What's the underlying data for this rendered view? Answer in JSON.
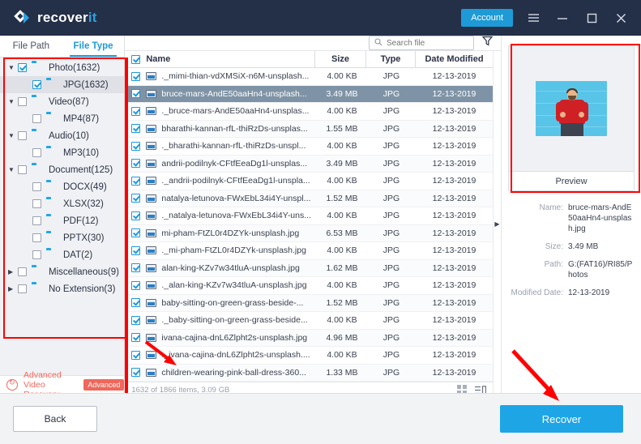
{
  "titlebar": {
    "logo_text_main": "recover",
    "logo_text_accent": "it",
    "account_label": "Account",
    "menu_icon": "hamburger-menu-icon",
    "minimize_icon": "minimize-icon",
    "maximize_icon": "maximize-icon",
    "close_icon": "close-icon",
    "bg_color": "#242f48",
    "accent_color": "#1e9ad6"
  },
  "sidebar": {
    "tabs": [
      {
        "label": "File Path",
        "active": false
      },
      {
        "label": "File Type",
        "active": true
      }
    ],
    "tree": [
      {
        "label": "Photo(1632)",
        "level": 0,
        "checked": true,
        "chevron": "open",
        "icon": "photo-icon",
        "selected": false
      },
      {
        "label": "JPG(1632)",
        "level": 1,
        "checked": true,
        "chevron": "none",
        "icon": "folder-icon",
        "selected": true
      },
      {
        "label": "Video(87)",
        "level": 0,
        "checked": false,
        "chevron": "open",
        "icon": "video-icon",
        "selected": false
      },
      {
        "label": "MP4(87)",
        "level": 1,
        "checked": false,
        "chevron": "none",
        "icon": "folder-icon",
        "selected": false
      },
      {
        "label": "Audio(10)",
        "level": 0,
        "checked": false,
        "chevron": "open",
        "icon": "audio-icon",
        "selected": false
      },
      {
        "label": "MP3(10)",
        "level": 1,
        "checked": false,
        "chevron": "none",
        "icon": "folder-icon",
        "selected": false
      },
      {
        "label": "Document(125)",
        "level": 0,
        "checked": false,
        "chevron": "open",
        "icon": "document-icon",
        "selected": false
      },
      {
        "label": "DOCX(49)",
        "level": 1,
        "checked": false,
        "chevron": "none",
        "icon": "folder-icon",
        "selected": false
      },
      {
        "label": "XLSX(32)",
        "level": 1,
        "checked": false,
        "chevron": "none",
        "icon": "folder-icon",
        "selected": false
      },
      {
        "label": "PDF(12)",
        "level": 1,
        "checked": false,
        "chevron": "none",
        "icon": "folder-icon",
        "selected": false
      },
      {
        "label": "PPTX(30)",
        "level": 1,
        "checked": false,
        "chevron": "none",
        "icon": "folder-icon",
        "selected": false
      },
      {
        "label": "DAT(2)",
        "level": 1,
        "checked": false,
        "chevron": "none",
        "icon": "folder-icon",
        "selected": false
      },
      {
        "label": "Miscellaneous(9)",
        "level": 0,
        "checked": false,
        "chevron": "closed",
        "icon": "misc-icon",
        "selected": false
      },
      {
        "label": "No Extension(3)",
        "level": 0,
        "checked": false,
        "chevron": "closed",
        "icon": "folder-icon",
        "selected": false
      }
    ],
    "advanced": {
      "label": "Advanced Video Recovery",
      "badge": "Advanced",
      "icon": "refresh-video-icon",
      "color": "#f0675c"
    }
  },
  "search": {
    "placeholder": "Search file",
    "value": "",
    "search_icon": "search-icon",
    "filter_icon": "filter-funnel-icon"
  },
  "filelist": {
    "columns": [
      "Name",
      "Size",
      "Type",
      "Date Modified"
    ],
    "header_checkbox_checked": true,
    "rows": [
      {
        "name": "._mimi-thian-vdXMSiX-n6M-unsplash...",
        "size": "4.00  KB",
        "type": "JPG",
        "date": "12-13-2019",
        "checked": true,
        "selected": false
      },
      {
        "name": "bruce-mars-AndE50aaHn4-unsplash...",
        "size": "3.49  MB",
        "type": "JPG",
        "date": "12-13-2019",
        "checked": true,
        "selected": true
      },
      {
        "name": "._bruce-mars-AndE50aaHn4-unsplas...",
        "size": "4.00  KB",
        "type": "JPG",
        "date": "12-13-2019",
        "checked": true,
        "selected": false
      },
      {
        "name": "bharathi-kannan-rfL-thiRzDs-unsplas...",
        "size": "1.55  MB",
        "type": "JPG",
        "date": "12-13-2019",
        "checked": true,
        "selected": false
      },
      {
        "name": "._bharathi-kannan-rfL-thiRzDs-unspl...",
        "size": "4.00  KB",
        "type": "JPG",
        "date": "12-13-2019",
        "checked": true,
        "selected": false
      },
      {
        "name": "andrii-podilnyk-CFtfEeaDg1l-unsplas...",
        "size": "3.49  MB",
        "type": "JPG",
        "date": "12-13-2019",
        "checked": true,
        "selected": false
      },
      {
        "name": "._andrii-podilnyk-CFtfEeaDg1l-unspla...",
        "size": "4.00  KB",
        "type": "JPG",
        "date": "12-13-2019",
        "checked": true,
        "selected": false
      },
      {
        "name": "natalya-letunova-FWxEbL34i4Y-unspl...",
        "size": "1.52  MB",
        "type": "JPG",
        "date": "12-13-2019",
        "checked": true,
        "selected": false
      },
      {
        "name": "._natalya-letunova-FWxEbL34i4Y-uns...",
        "size": "4.00  KB",
        "type": "JPG",
        "date": "12-13-2019",
        "checked": true,
        "selected": false
      },
      {
        "name": "mi-pham-FtZL0r4DZYk-unsplash.jpg",
        "size": "6.53  MB",
        "type": "JPG",
        "date": "12-13-2019",
        "checked": true,
        "selected": false
      },
      {
        "name": "._mi-pham-FtZL0r4DZYk-unsplash.jpg",
        "size": "4.00  KB",
        "type": "JPG",
        "date": "12-13-2019",
        "checked": true,
        "selected": false
      },
      {
        "name": "alan-king-KZv7w34tluA-unsplash.jpg",
        "size": "1.62  MB",
        "type": "JPG",
        "date": "12-13-2019",
        "checked": true,
        "selected": false
      },
      {
        "name": "._alan-king-KZv7w34tluA-unsplash.jpg",
        "size": "4.00  KB",
        "type": "JPG",
        "date": "12-13-2019",
        "checked": true,
        "selected": false
      },
      {
        "name": "baby-sitting-on-green-grass-beside-...",
        "size": "1.52  MB",
        "type": "JPG",
        "date": "12-13-2019",
        "checked": true,
        "selected": false
      },
      {
        "name": "._baby-sitting-on-green-grass-beside...",
        "size": "4.00  KB",
        "type": "JPG",
        "date": "12-13-2019",
        "checked": true,
        "selected": false
      },
      {
        "name": "ivana-cajina-dnL6Zlpht2s-unsplash.jpg",
        "size": "4.96  MB",
        "type": "JPG",
        "date": "12-13-2019",
        "checked": true,
        "selected": false
      },
      {
        "name": "._ivana-cajina-dnL6Zlpht2s-unsplash....",
        "size": "4.00  KB",
        "type": "JPG",
        "date": "12-13-2019",
        "checked": true,
        "selected": false
      },
      {
        "name": "children-wearing-pink-ball-dress-360...",
        "size": "1.33  MB",
        "type": "JPG",
        "date": "12-13-2019",
        "checked": true,
        "selected": false
      }
    ],
    "status": "1632 of 1866 items, 3.09  GB",
    "grid_view_icon": "grid-view-icon",
    "list_view_icon": "list-view-icon"
  },
  "preview": {
    "button_label": "Preview",
    "image_alt": "man-in-red-sweater-against-cyan-brick-wall",
    "meta": [
      {
        "key": "Name:",
        "value": "bruce-mars-AndE50aaHn4-unsplash.jpg"
      },
      {
        "key": "Size:",
        "value": "3.49  MB"
      },
      {
        "key": "Path:",
        "value": "G:(FAT16)/RI85/Photos"
      },
      {
        "key": "Modified Date:",
        "value": "12-13-2019"
      }
    ]
  },
  "footer": {
    "back_label": "Back",
    "recover_label": "Recover",
    "recover_color": "#1ea5e6"
  },
  "annotations": {
    "highlight_color": "#ff0000"
  }
}
